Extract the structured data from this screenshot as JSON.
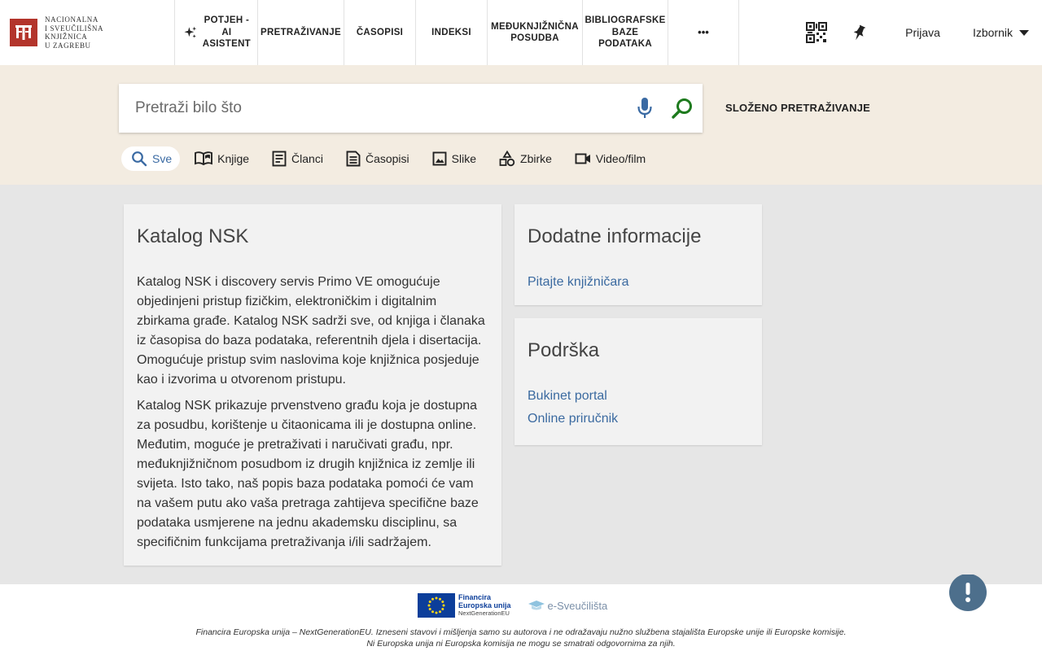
{
  "brand": {
    "logo_lines": [
      "NACIONALNA",
      "I SVEUČILIŠNA",
      "KNJIŽNICA",
      "U ZAGREBU"
    ],
    "logo_color": "#b3342b"
  },
  "nav": {
    "ai_lines": [
      "POTJEH -",
      "AI",
      "ASISTENT"
    ],
    "items": [
      {
        "lines": [
          "PRETRAŽIVANJE"
        ]
      },
      {
        "lines": [
          "ČASOPISI"
        ]
      },
      {
        "lines": [
          "INDEKSI"
        ]
      },
      {
        "lines": [
          "MEĐUKNJIŽNIČNA",
          "POSUDBA"
        ]
      },
      {
        "lines": [
          "BIBLIOGRAFSKE",
          "BAZE",
          "PODATAKA"
        ]
      }
    ],
    "more_label": "•••"
  },
  "header_right": {
    "qr_icon": "qr-code-icon",
    "pin_icon": "pin-icon",
    "login_label": "Prijava",
    "menu_label": "Izbornik"
  },
  "search": {
    "placeholder": "Pretraži bilo što",
    "value": "",
    "advanced_label": "SLOŽENO PRETRAŽIVANJE",
    "accent_color": "#1d7a1d"
  },
  "scopes": [
    {
      "label": "Sve",
      "icon": "search-icon",
      "active": true
    },
    {
      "label": "Knjige",
      "icon": "book-icon"
    },
    {
      "label": "Članci",
      "icon": "article-icon"
    },
    {
      "label": "Časopisi",
      "icon": "journal-icon"
    },
    {
      "label": "Slike",
      "icon": "image-icon"
    },
    {
      "label": "Zbirke",
      "icon": "collection-icon"
    },
    {
      "label": "Video/film",
      "icon": "video-icon"
    }
  ],
  "katalog": {
    "title": "Katalog NSK",
    "paragraphs": [
      "Katalog NSK i discovery servis Primo VE omogućuje objedinjeni pristup fizičkim, elektroničkim i digitalnim zbirkama građe. Katalog NSK sadrži sve, od knjiga i članaka iz časopisa do baza podataka, referentnih djela i disertacija. Omogućuje pristup svim naslovima koje knjižnica posjeduje kao i izvorima u otvorenom pristupu.",
      "Katalog NSK prikazuje prvenstveno građu koja je dostupna za posudbu, korištenje u čitaonicama ili je dostupna online. Međutim, moguće je pretraživati i naručivati građu, npr. međuknjižničnom posudbom iz drugih knjižnica iz zemlje ili svijeta. Isto tako, naš popis baza podataka pomoći će vam na vašem putu ako vaša pretraga zahtijeva specifične baze podataka usmjerene na jednu akademsku disciplinu, sa specifičnim funkcijama pretraživanja i/ili sadržajem."
    ]
  },
  "dodatne": {
    "title": "Dodatne informacije",
    "links": [
      "Pitajte knjižničara"
    ]
  },
  "podrska": {
    "title": "Podrška",
    "links": [
      "Bukinet portal",
      "Online priručnik"
    ]
  },
  "footer": {
    "eu_line1": "Financira",
    "eu_line2": "Europska unija",
    "eu_line3": "NextGenerationEU",
    "esveu_label": "e-Sveučilišta",
    "note_line1": "Financira Europska unija – NextGenerationEU. Izneseni stavovi i mišljenja samo su autorova i ne odražavaju nužno službena stajališta Europske unije ili Europske komisije.",
    "note_line2": "Ni Europska unija ni Europska komisija ne mogu se smatrati odgovornima za njih."
  },
  "help": {
    "icon": "feedback-icon",
    "color": "#4d6f8c"
  }
}
